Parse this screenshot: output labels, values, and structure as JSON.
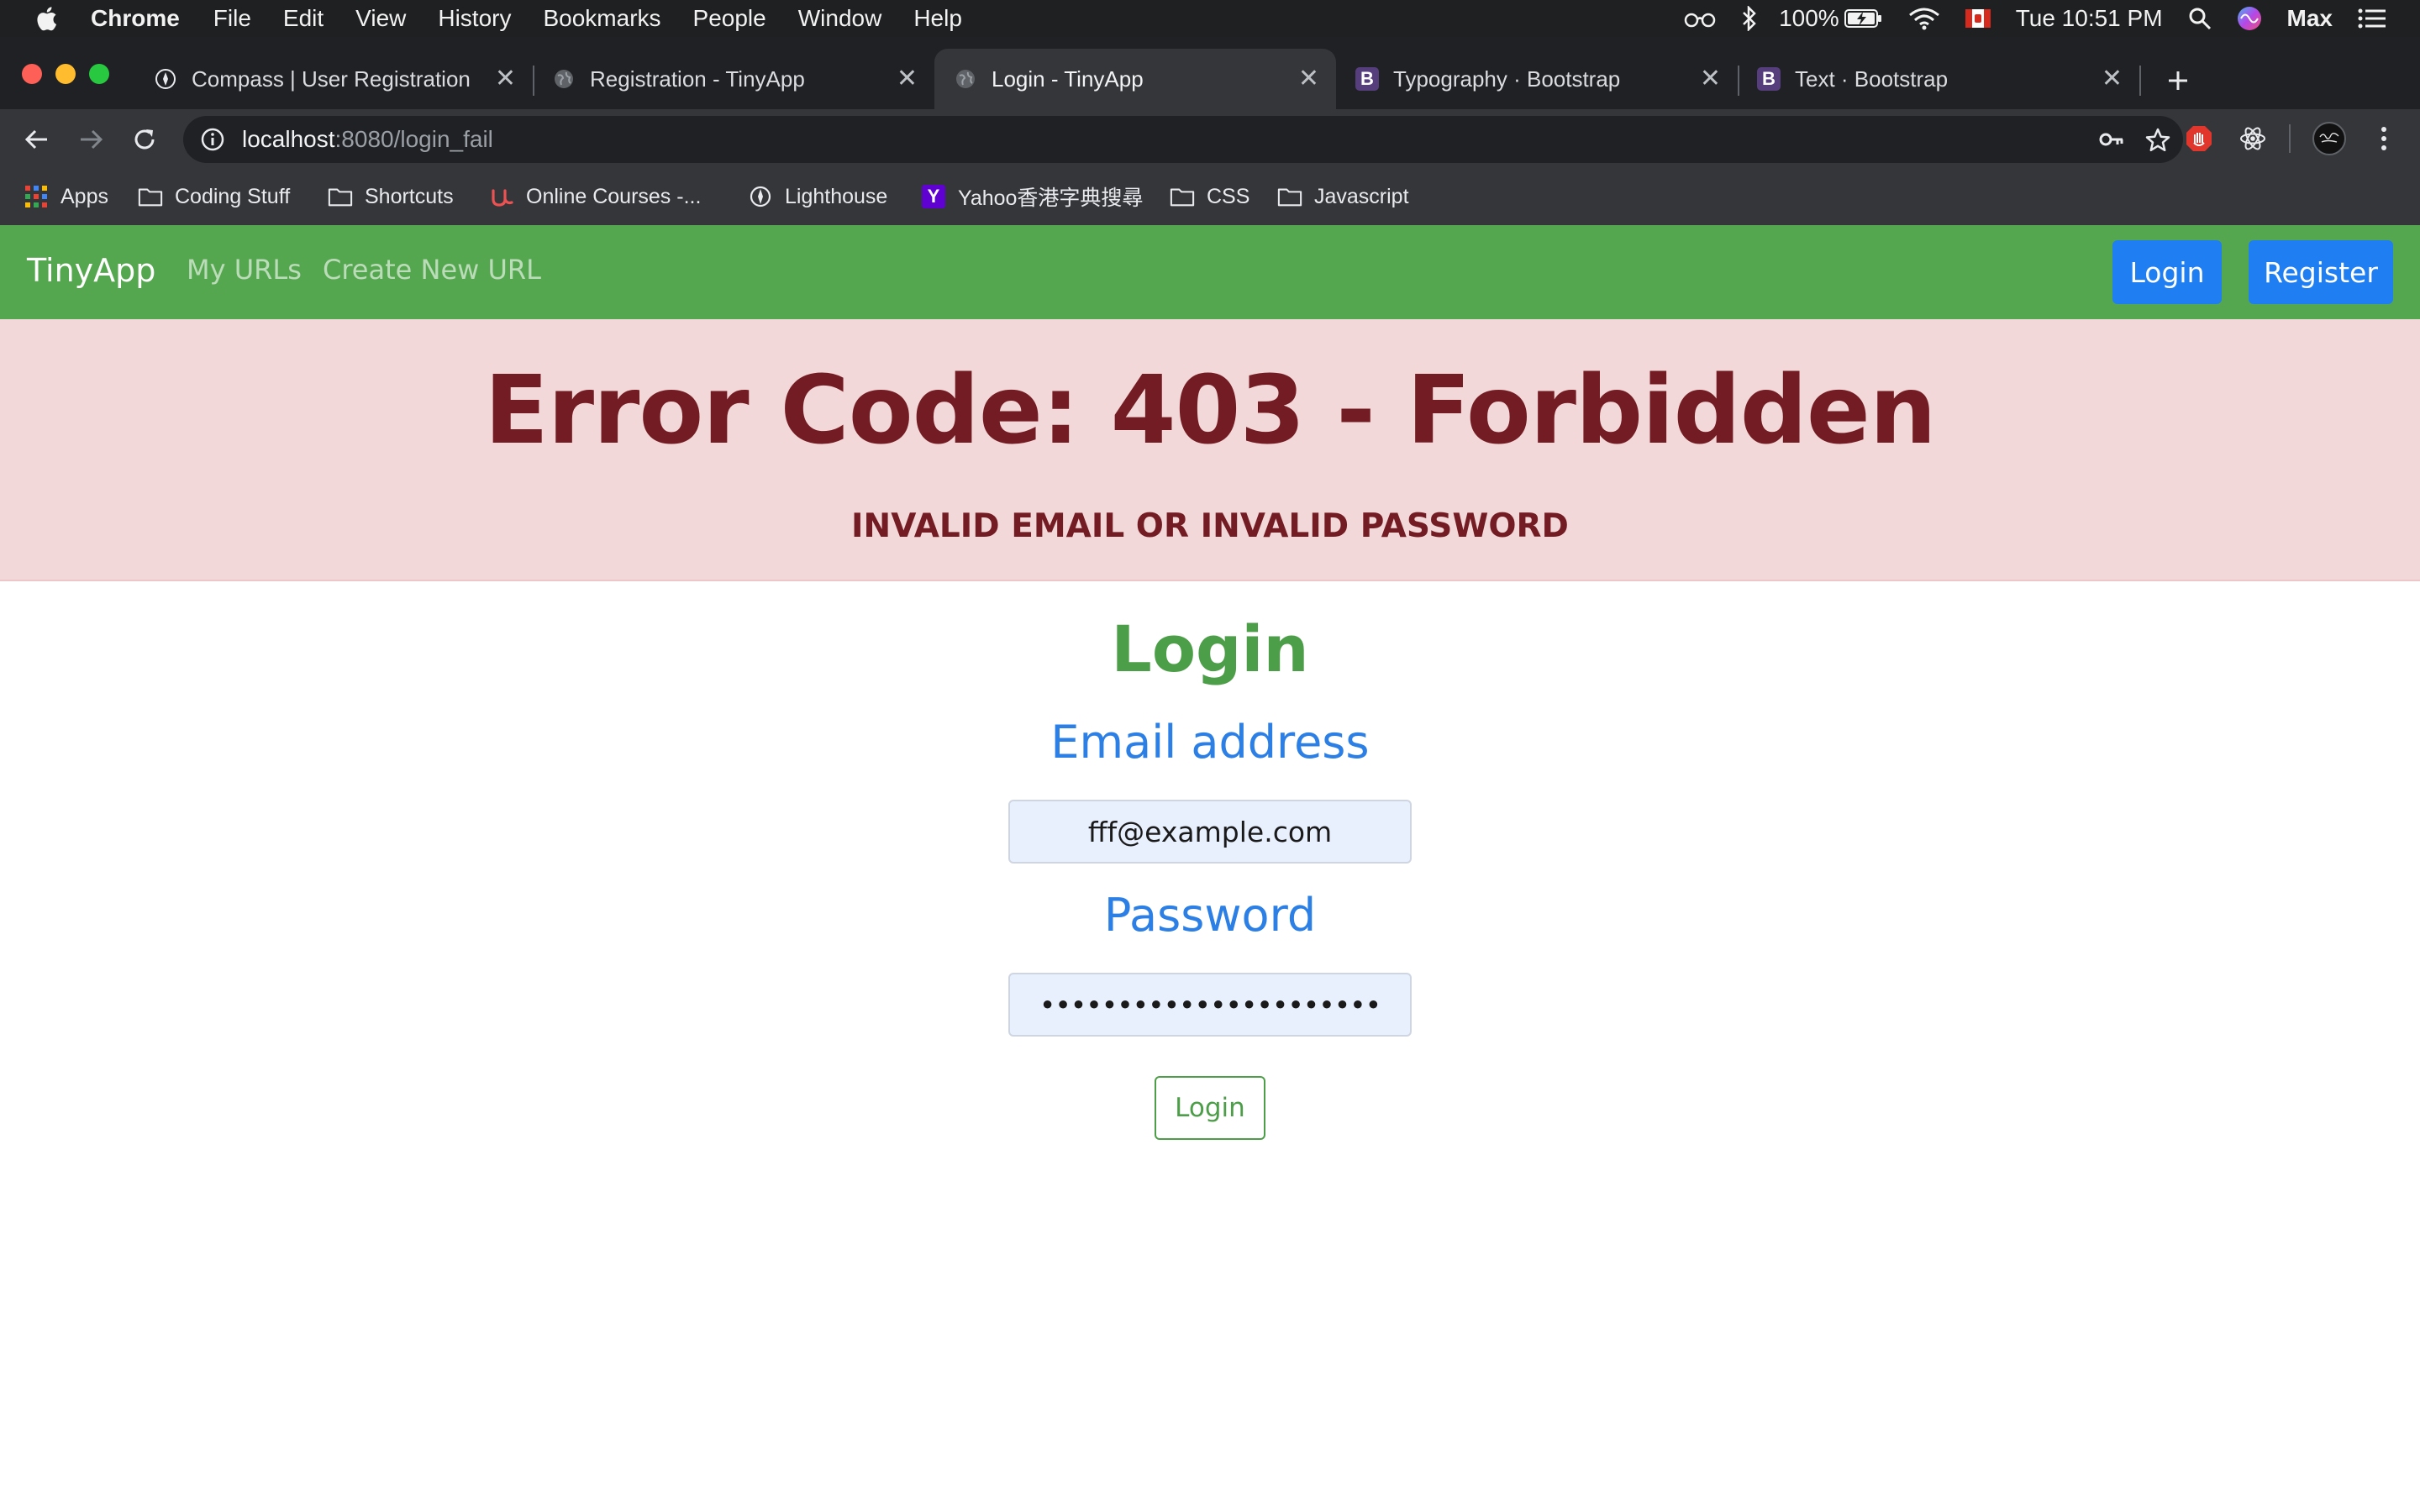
{
  "menubar": {
    "app_name": "Chrome",
    "menus": [
      "File",
      "Edit",
      "View",
      "History",
      "Bookmarks",
      "People",
      "Window",
      "Help"
    ],
    "battery": "100%",
    "clock": "Tue 10:51 PM",
    "user": "Max"
  },
  "tabs": [
    {
      "title": "Compass | User Registration",
      "icon": "compass-icon"
    },
    {
      "title": "Registration - TinyApp",
      "icon": "globe-icon"
    },
    {
      "title": "Login - TinyApp",
      "icon": "globe-icon",
      "active": true
    },
    {
      "title": "Typography · Bootstrap",
      "icon": "bootstrap-icon",
      "icon_letter": "B"
    },
    {
      "title": "Text · Bootstrap",
      "icon": "bootstrap-icon",
      "icon_letter": "B"
    }
  ],
  "address": {
    "host": "localhost",
    "path": ":8080/login_fail"
  },
  "bookmarks": [
    {
      "label": "Apps",
      "icon": "apps-grid-icon"
    },
    {
      "label": "Coding Stuff",
      "icon": "folder-icon"
    },
    {
      "label": "Shortcuts",
      "icon": "folder-icon"
    },
    {
      "label": "Online Courses -...",
      "icon": "udemy-icon"
    },
    {
      "label": "Lighthouse",
      "icon": "compass-icon"
    },
    {
      "label": "Yahoo香港字典搜尋",
      "icon": "yahoo-icon",
      "icon_letter": "Y"
    },
    {
      "label": "CSS",
      "icon": "folder-icon"
    },
    {
      "label": "Javascript",
      "icon": "folder-icon"
    }
  ],
  "navbar": {
    "brand": "TinyApp",
    "links": [
      "My URLs",
      "Create New URL"
    ],
    "login_button": "Login",
    "register_button": "Register"
  },
  "alert": {
    "heading": "Error Code: 403 - Forbidden",
    "message": "INVALID EMAIL OR INVALID PASSWORD"
  },
  "login_form": {
    "title": "Login",
    "email_label": "Email address",
    "email_value": "fff@example.com",
    "password_label": "Password",
    "password_masked": "••••••••••••••••••••••",
    "submit_label": "Login"
  },
  "colors": {
    "navbar": "#55a74f",
    "primary": "#1f7ef2",
    "danger_bg": "#f3d8d9",
    "danger_text": "#731c23",
    "success": "#4d9e48",
    "label_blue": "#2b7fe5"
  }
}
